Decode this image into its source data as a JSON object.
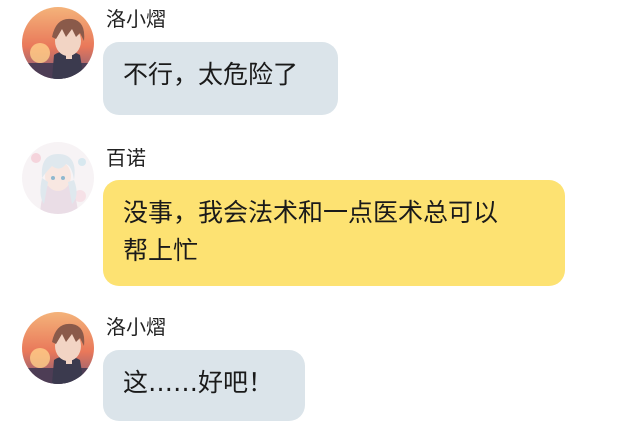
{
  "colors": {
    "bubble_grey": "#dbe4ea",
    "bubble_yellow": "#fde272",
    "background": "#ffffff",
    "text": "#1a1a1a"
  },
  "messages": [
    {
      "sender": "洛小熠",
      "avatar_icon": "anime-boy-sunset-avatar-icon",
      "bubble_color": "grey",
      "lines": [
        "不行，太危险了"
      ]
    },
    {
      "sender": "百诺",
      "avatar_icon": "anime-girl-white-hair-avatar-icon",
      "bubble_color": "yellow",
      "lines": [
        "没事，我会法术和一点医术总可以",
        "帮上忙"
      ]
    },
    {
      "sender": "洛小熠",
      "avatar_icon": "anime-boy-sunset-avatar-icon",
      "bubble_color": "grey",
      "lines": [
        "这……好吧！"
      ]
    }
  ]
}
